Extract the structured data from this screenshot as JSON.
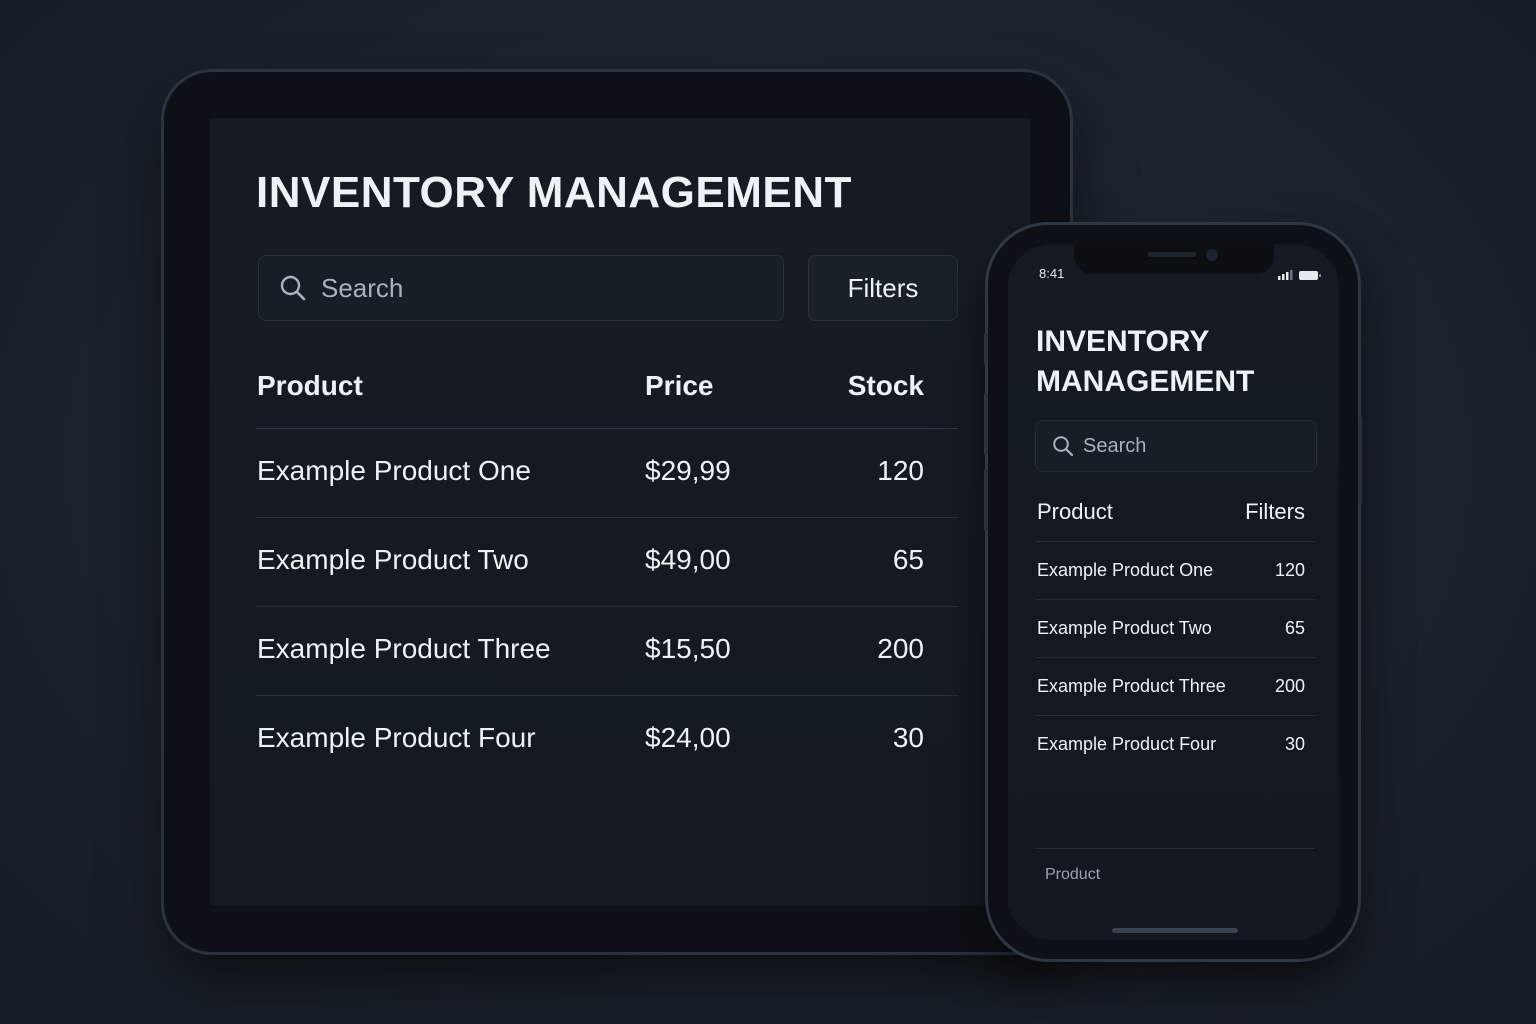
{
  "tablet": {
    "title": "INVENTORY MANAGEMENT",
    "search": {
      "placeholder": "Search"
    },
    "filters_label": "Filters",
    "table": {
      "headers": {
        "product": "Product",
        "price": "Price",
        "stock": "Stock"
      },
      "rows": [
        {
          "product": "Example Product One",
          "price": "$29,99",
          "stock": "120"
        },
        {
          "product": "Example Product Two",
          "price": "$49,00",
          "stock": "65"
        },
        {
          "product": "Example Product Three",
          "price": "$15,50",
          "stock": "200"
        },
        {
          "product": "Example Product Four",
          "price": "$24,00",
          "stock": "30"
        }
      ]
    }
  },
  "phone": {
    "status": {
      "time": "8:41"
    },
    "title_line1": "INVENTORY",
    "title_line2": "MANAGEMENT",
    "search": {
      "placeholder": "Search"
    },
    "table": {
      "headers": {
        "product": "Product",
        "filters": "Filters"
      },
      "rows": [
        {
          "product": "Example Product One",
          "stock": "120"
        },
        {
          "product": "Example Product Two",
          "stock": "65"
        },
        {
          "product": "Example Product Three",
          "stock": "200"
        },
        {
          "product": "Example Product Four",
          "stock": "30"
        }
      ]
    },
    "bottom_tab_label": "Product"
  },
  "icons": {
    "search": "search-icon",
    "signal": "signal-icon",
    "battery": "battery-icon"
  },
  "colors": {
    "background": "#1b222c",
    "screen": "#151a22",
    "text": "#eef1f5",
    "muted": "#aab2bd",
    "border": "#2a313b"
  }
}
